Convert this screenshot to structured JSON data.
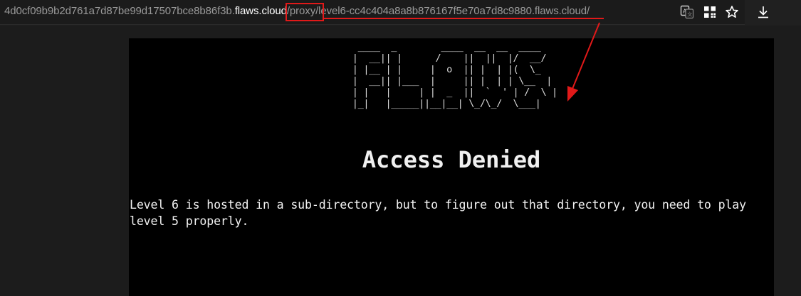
{
  "browser": {
    "url_subdomain": "4d0cf09b9b2d761a7d87be99d17507bce8b86f3b.",
    "url_domain": "flaws.cloud",
    "url_path_proxy": "/proxy/",
    "url_path_rest": "level6-cc4c404a8a8b876167f5e70a7d8c9880.flaws.cloud/",
    "icons": [
      "translate-icon",
      "apps-icon",
      "star-icon",
      "download-icon"
    ]
  },
  "page": {
    "logo_ascii": "  ____  _        ____  __  __  ____\n |  __|| |      /    ||  ||  |/  __/\n | |__ | |     |  o  || |  | |(  \\_\n |  __|| |___  |     || |  | | \\__  |\n | |   |     | |  _  ||  `  ' | /  \\ |\n |_|   |_____||__|__| \\_/\\_/  \\___|",
    "heading": "Access Denied",
    "message": "Level 6 is hosted in a sub-directory, but to figure out that directory, you need to play level 5 properly."
  },
  "annotation": {
    "color": "#e11919"
  }
}
